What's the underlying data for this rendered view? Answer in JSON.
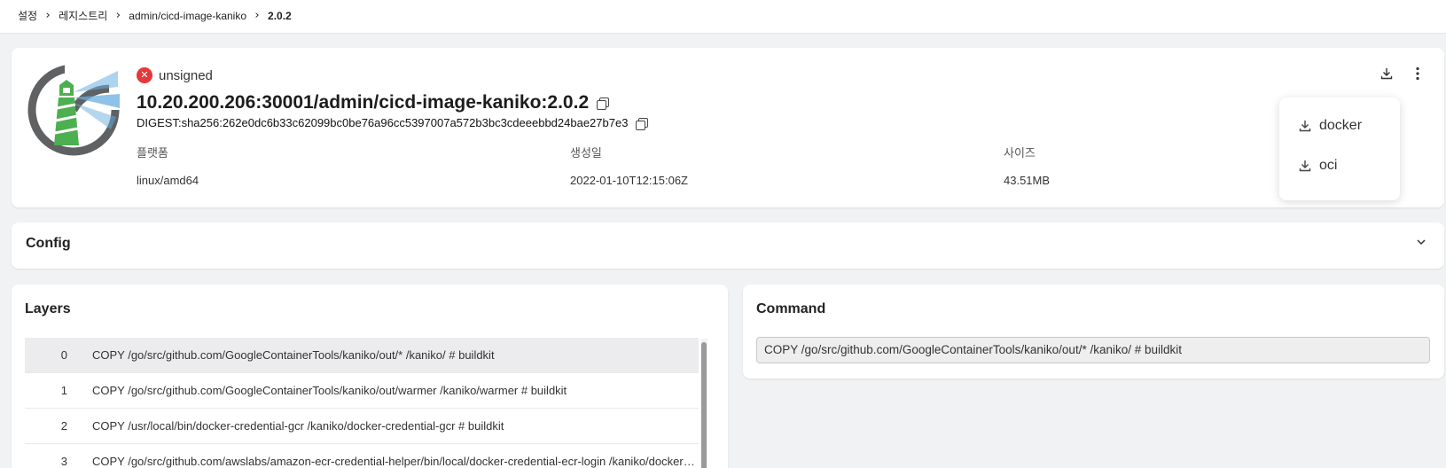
{
  "breadcrumb": {
    "items": [
      "설정",
      "레지스트리",
      "admin/cicd-image-kaniko",
      "2.0.2"
    ],
    "separator": "›"
  },
  "header": {
    "signature_status": "unsigned",
    "signature_icon": "x-circle-icon",
    "image_title": "10.20.200.206:30001/admin/cicd-image-kaniko:2.0.2",
    "digest": "DIGEST:sha256:262e0dc6b33c62099bc0be76a96cc5397007a572b3bc3cdeeebbd24bae27b7e3",
    "platform_label": "플랫폼",
    "platform_value": "linux/amd64",
    "created_label": "생성일",
    "created_value": "2022-01-10T12:15:06Z",
    "size_label": "사이즈",
    "size_value": "43.51MB"
  },
  "download_menu": {
    "items": [
      "docker",
      "oci"
    ]
  },
  "config": {
    "title": "Config"
  },
  "layers": {
    "title": "Layers",
    "rows": [
      {
        "index": "0",
        "command": "COPY /go/src/github.com/GoogleContainerTools/kaniko/out/* /kaniko/ # buildkit"
      },
      {
        "index": "1",
        "command": "COPY /go/src/github.com/GoogleContainerTools/kaniko/out/warmer /kaniko/warmer # buildkit"
      },
      {
        "index": "2",
        "command": "COPY /usr/local/bin/docker-credential-gcr /kaniko/docker-credential-gcr # buildkit"
      },
      {
        "index": "3",
        "command": "COPY /go/src/github.com/awslabs/amazon-ecr-credential-helper/bin/local/docker-credential-ecr-login /kaniko/docker-credential-ecr-login # buildkit"
      }
    ],
    "selected_index": 0
  },
  "command": {
    "title": "Command",
    "value": "COPY /go/src/github.com/GoogleContainerTools/kaniko/out/* /kaniko/ # buildkit"
  },
  "colors": {
    "accent_error": "#e5383b",
    "logo_ring": "#5f6163",
    "logo_tower": "#4caf50",
    "logo_beam": "#6aaee0"
  }
}
